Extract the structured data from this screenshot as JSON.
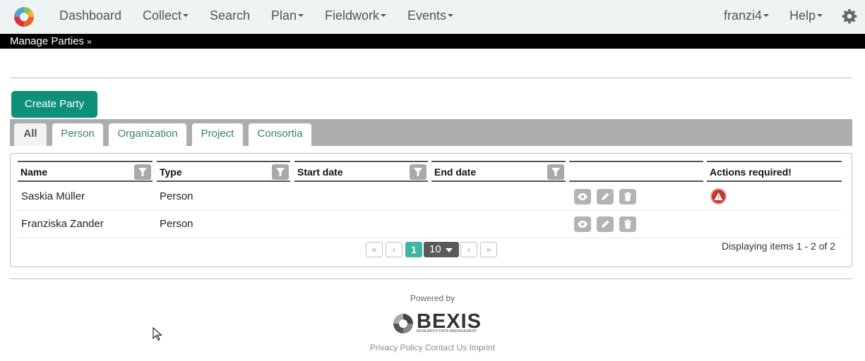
{
  "nav": {
    "items": [
      {
        "label": "Dashboard",
        "dropdown": false
      },
      {
        "label": "Collect",
        "dropdown": true
      },
      {
        "label": "Search",
        "dropdown": false
      },
      {
        "label": "Plan",
        "dropdown": true
      },
      {
        "label": "Fieldwork",
        "dropdown": true
      },
      {
        "label": "Events",
        "dropdown": true
      }
    ],
    "user": "franzi4",
    "help": "Help",
    "settings_icon": "gear-icon"
  },
  "subbar": {
    "label": "Manage Parties"
  },
  "toolbar": {
    "create_label": "Create Party"
  },
  "tabs": [
    {
      "label": "All",
      "active": true
    },
    {
      "label": "Person",
      "active": false
    },
    {
      "label": "Organization",
      "active": false
    },
    {
      "label": "Project",
      "active": false
    },
    {
      "label": "Consortia",
      "active": false
    }
  ],
  "grid": {
    "columns": [
      "Name",
      "Type",
      "Start date",
      "End date",
      "",
      "Actions required!"
    ],
    "rows": [
      {
        "name": "Saskia Müller",
        "type": "Person",
        "start": "",
        "end": "",
        "actions_required": true
      },
      {
        "name": "Franziska Zander",
        "type": "Person",
        "start": "",
        "end": "",
        "actions_required": false
      }
    ],
    "pager": {
      "first": "«",
      "prev": "‹",
      "current_page": "1",
      "page_size": "10",
      "next": "›",
      "last": "»",
      "info": "Displaying items 1 - 2 of 2"
    }
  },
  "footer": {
    "powered_by": "Powered by",
    "brand": "BEXIS",
    "brand_sub": "RESEARCH DATA MANAGEMENT",
    "links": [
      "Privacy Policy",
      "Contact Us",
      "Imprint"
    ]
  },
  "colors": {
    "accent": "#0e8f77",
    "page_current": "#3fb5a3",
    "warning": "#c0392b",
    "navbar_bg": "#eef4f4"
  }
}
